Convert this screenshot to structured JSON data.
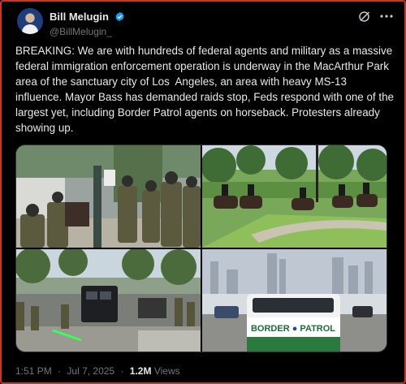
{
  "author": {
    "display_name": "Bill Melugin",
    "handle": "@BillMelugin_",
    "verified": true
  },
  "header_icons": [
    "grok-icon",
    "more-options-icon"
  ],
  "tweet": {
    "text": "BREAKING: We are with hundreds of federal agents and military as a massive federal immigration enforcement operation is underway in the MacArthur Park area of the sanctuary city of Los  Angeles, an area with heavy MS-13 influence. Mayor Bass has demanded raids stop, Feds respond with one of the largest yet, including Border Patrol agents on horseback. Protesters already showing up."
  },
  "media": {
    "images": [
      {
        "name": "agents-on-street-photo"
      },
      {
        "name": "horseback-agents-park-photo"
      },
      {
        "name": "armored-vehicle-street-photo"
      },
      {
        "name": "border-patrol-truck-photo",
        "vehicle_text": "BORDER",
        "vehicle_text_2": "PATROL"
      }
    ]
  },
  "meta": {
    "time": "1:51 PM",
    "date": "Jul 7, 2025",
    "dot": "·",
    "views_count": "1.2M",
    "views_label": "Views"
  },
  "colors": {
    "background": "#000000",
    "text": "#e7e9ea",
    "secondary_text": "#71767b",
    "verified_blue": "#1d9bf0",
    "frame_border": "#c0392b"
  }
}
